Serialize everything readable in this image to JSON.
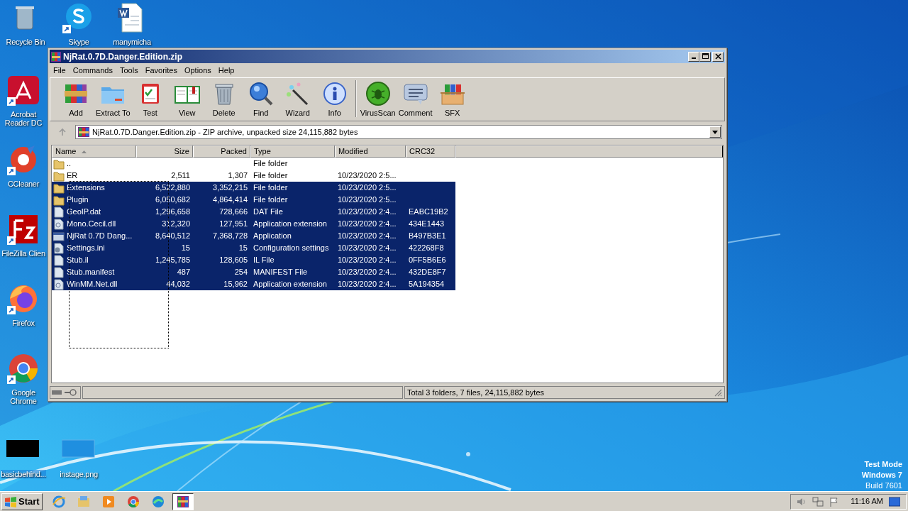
{
  "desktop_icons": [
    {
      "label": "Recycle Bin",
      "kind": "recycle"
    },
    {
      "label": "Skype",
      "kind": "skype"
    },
    {
      "label": "manymicha",
      "kind": "word"
    },
    {
      "label": "Acrobat Reader DC",
      "kind": "acrobat"
    },
    {
      "label": "CCleaner",
      "kind": "ccleaner"
    },
    {
      "label": "FileZilla Clien",
      "kind": "filezilla"
    },
    {
      "label": "Firefox",
      "kind": "firefox"
    },
    {
      "label": "Google Chrome",
      "kind": "chrome"
    },
    {
      "label": "basicbehind...",
      "kind": "black"
    },
    {
      "label": "instage.png"
    }
  ],
  "window": {
    "title": "NjRat.0.7D.Danger.Edition.zip",
    "menu": [
      "File",
      "Commands",
      "Tools",
      "Favorites",
      "Options",
      "Help"
    ],
    "toolbar": [
      {
        "label": "Add",
        "kind": "add"
      },
      {
        "label": "Extract To",
        "kind": "extract"
      },
      {
        "label": "Test",
        "kind": "test"
      },
      {
        "label": "View",
        "kind": "view"
      },
      {
        "label": "Delete",
        "kind": "delete"
      },
      {
        "label": "Find",
        "kind": "find"
      },
      {
        "label": "Wizard",
        "kind": "wizard"
      },
      {
        "label": "Info",
        "kind": "info"
      },
      {
        "label": "VirusScan",
        "kind": "virus"
      },
      {
        "label": "Comment",
        "kind": "comment"
      },
      {
        "label": "SFX",
        "kind": "sfx"
      }
    ],
    "address": "NjRat.0.7D.Danger.Edition.zip - ZIP archive, unpacked size 24,115,882 bytes",
    "columns": [
      {
        "label": "Name",
        "sorted": true
      },
      {
        "label": "Size",
        "sorted": false
      },
      {
        "label": "Packed",
        "sorted": false
      },
      {
        "label": "Type",
        "sorted": false
      },
      {
        "label": "Modified",
        "sorted": false
      },
      {
        "label": "CRC32",
        "sorted": false
      }
    ],
    "rows": [
      {
        "name": "..",
        "size": "",
        "packed": "",
        "type": "File folder",
        "modified": "",
        "crc": "",
        "kind": "folder",
        "selected": false
      },
      {
        "name": "ER",
        "size": "2,511",
        "packed": "1,307",
        "type": "File folder",
        "modified": "10/23/2020 2:5...",
        "crc": "",
        "kind": "folder",
        "selected": false
      },
      {
        "name": "Extensions",
        "size": "6,522,880",
        "packed": "3,352,215",
        "type": "File folder",
        "modified": "10/23/2020 2:5...",
        "crc": "",
        "kind": "folder",
        "selected": true
      },
      {
        "name": "Plugin",
        "size": "6,050,682",
        "packed": "4,864,414",
        "type": "File folder",
        "modified": "10/23/2020 2:5...",
        "crc": "",
        "kind": "folder",
        "selected": true
      },
      {
        "name": "GeoIP.dat",
        "size": "1,296,658",
        "packed": "728,666",
        "type": "DAT File",
        "modified": "10/23/2020 2:4...",
        "crc": "EABC19B2",
        "kind": "file",
        "selected": true
      },
      {
        "name": "Mono.Cecil.dll",
        "size": "312,320",
        "packed": "127,951",
        "type": "Application extension",
        "modified": "10/23/2020 2:4...",
        "crc": "434E1443",
        "kind": "dll",
        "selected": true
      },
      {
        "name": "NjRat 0.7D Dang...",
        "size": "8,640,512",
        "packed": "7,368,728",
        "type": "Application",
        "modified": "10/23/2020 2:4...",
        "crc": "B497B3E1",
        "kind": "app",
        "selected": true
      },
      {
        "name": "Settings.ini",
        "size": "15",
        "packed": "15",
        "type": "Configuration settings",
        "modified": "10/23/2020 2:4...",
        "crc": "422268F8",
        "kind": "settings",
        "selected": true
      },
      {
        "name": "Stub.il",
        "size": "1,245,785",
        "packed": "128,605",
        "type": "IL File",
        "modified": "10/23/2020 2:4...",
        "crc": "0FF5B6E6",
        "kind": "file",
        "selected": true
      },
      {
        "name": "Stub.manifest",
        "size": "487",
        "packed": "254",
        "type": "MANIFEST File",
        "modified": "10/23/2020 2:4...",
        "crc": "432DE8F7",
        "kind": "file",
        "selected": true
      },
      {
        "name": "WinMM.Net.dll",
        "size": "44,032",
        "packed": "15,962",
        "type": "Application extension",
        "modified": "10/23/2020 2:4...",
        "crc": "5A194354",
        "kind": "dll",
        "selected": true
      }
    ],
    "status": "Total 3 folders, 7 files, 24,115,882 bytes"
  },
  "taskbar": {
    "start": "Start",
    "apps": [
      {
        "kind": "ie",
        "active": false
      },
      {
        "kind": "explorer",
        "active": false
      },
      {
        "kind": "media",
        "active": false
      },
      {
        "kind": "chrome",
        "active": false
      },
      {
        "kind": "edge",
        "active": false
      },
      {
        "kind": "winrar",
        "active": true
      }
    ],
    "clock": "11:16 AM"
  },
  "os_notice": [
    "Test Mode",
    "Windows 7",
    "Build 7601"
  ]
}
